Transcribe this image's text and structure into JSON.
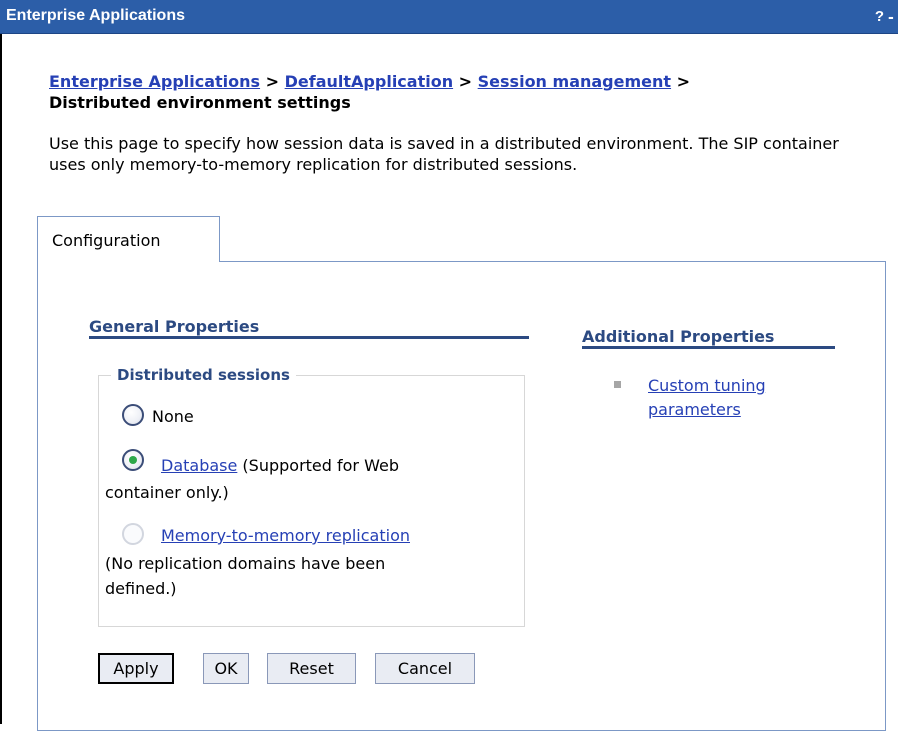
{
  "window": {
    "title": "Enterprise Applications",
    "help_label": "?",
    "minimize_label": "-"
  },
  "breadcrumb": {
    "links": [
      "Enterprise Applications",
      "DefaultApplication",
      "Session management"
    ],
    "separator": ">",
    "current": "Distributed environment settings"
  },
  "description": "Use this page to specify how session data is saved in a distributed environment. The SIP container uses only memory-to-memory replication for distributed sessions.",
  "tabs": [
    {
      "label": "Configuration",
      "selected": true
    }
  ],
  "general_properties": {
    "title": "General Properties",
    "fieldset_legend": "Distributed sessions",
    "options": [
      {
        "label": "None",
        "selected": false,
        "enabled": true
      },
      {
        "link": "Database",
        "suffix": " (Supported for Web",
        "suffix2": "container only.)",
        "selected": true,
        "enabled": true
      },
      {
        "link": "Memory-to-memory replication",
        "note_line1": "(No replication domains have been",
        "note_line2": "defined.)",
        "selected": false,
        "enabled": false
      }
    ]
  },
  "additional_properties": {
    "title": "Additional Properties",
    "links": [
      {
        "line1": "Custom tuning",
        "line2": "parameters"
      }
    ]
  },
  "buttons": {
    "apply": "Apply",
    "ok": "OK",
    "reset": "Reset",
    "cancel": "Cancel"
  }
}
